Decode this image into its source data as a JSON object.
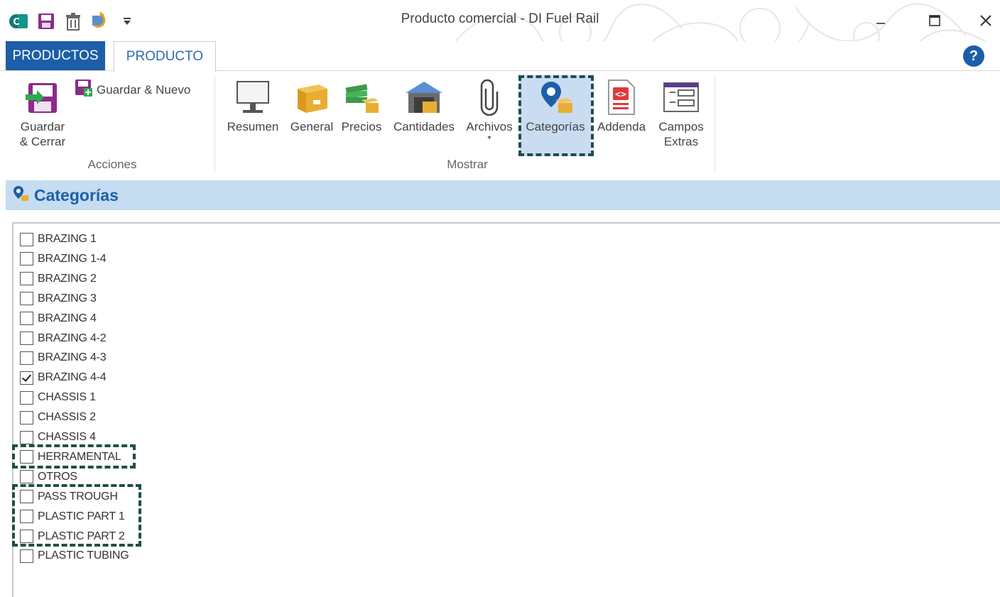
{
  "window": {
    "title": "Producto comercial - DI Fuel Rail",
    "minimize_glyph": "–",
    "maximize_glyph": "🗖",
    "close_glyph": "✕"
  },
  "quick_access": [
    {
      "name": "app-icon"
    },
    {
      "name": "save-icon"
    },
    {
      "name": "delete-icon"
    },
    {
      "name": "refresh-icon"
    },
    {
      "name": "customize-dropdown-icon"
    }
  ],
  "tabs": {
    "file_tab": "PRODUCTOS",
    "active_tab": "PRODUCTO"
  },
  "help": {
    "glyph": "?"
  },
  "ribbon": {
    "acciones": {
      "guardar_cerrar": "Guardar\n& Cerrar",
      "guardar_nuevo": "Guardar & Nuevo",
      "group_label": "Acciones"
    },
    "mostrar": {
      "items": [
        "Resumen",
        "General",
        "Precios",
        "Cantidades",
        "Archivos",
        "Categorías",
        "Addenda",
        "Campos\nExtras"
      ],
      "group_label": "Mostrar",
      "selected": "Categorías"
    }
  },
  "section": {
    "title": "Categorías"
  },
  "categories": [
    {
      "label": "BRAZING 1",
      "checked": false
    },
    {
      "label": "BRAZING 1-4",
      "checked": false
    },
    {
      "label": "BRAZING 2",
      "checked": false
    },
    {
      "label": "BRAZING 3",
      "checked": false
    },
    {
      "label": "BRAZING 4",
      "checked": false
    },
    {
      "label": "BRAZING 4-2",
      "checked": false
    },
    {
      "label": "BRAZING 4-3",
      "checked": false
    },
    {
      "label": "BRAZING 4-4",
      "checked": true
    },
    {
      "label": "CHASSIS 1",
      "checked": false
    },
    {
      "label": "CHASSIS 2",
      "checked": false
    },
    {
      "label": "CHASSIS 4",
      "checked": false
    },
    {
      "label": "HERRAMENTAL",
      "checked": false
    },
    {
      "label": "OTROS",
      "checked": false
    },
    {
      "label": "PASS TROUGH",
      "checked": false
    },
    {
      "label": "PLASTIC PART 1",
      "checked": false
    },
    {
      "label": "PLASTIC PART 2",
      "checked": false
    },
    {
      "label": "PLASTIC TUBING",
      "checked": false
    }
  ],
  "colors": {
    "accent": "#1d5ea8",
    "header_band": "#c6dcf1",
    "highlight_dash": "#1f4e4a"
  }
}
